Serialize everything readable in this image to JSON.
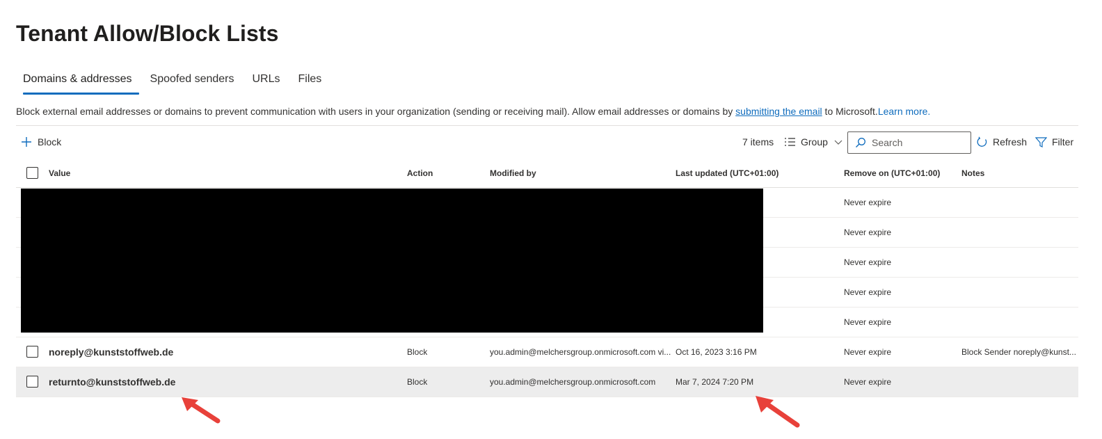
{
  "page": {
    "title": "Tenant Allow/Block Lists"
  },
  "tabs": [
    {
      "label": "Domains & addresses",
      "active": true
    },
    {
      "label": "Spoofed senders",
      "active": false
    },
    {
      "label": "URLs",
      "active": false
    },
    {
      "label": "Files",
      "active": false
    }
  ],
  "description": {
    "text": "Block external email addresses or domains to prevent communication with users in your organization (sending or receiving mail). Allow email addresses or domains by ",
    "link": "submitting the email",
    "after": " to Microsoft.",
    "learn_more": "Learn more."
  },
  "toolbar": {
    "block_label": "Block",
    "items_count": "7 items",
    "group_label": "Group",
    "search_placeholder": "Search",
    "refresh_label": "Refresh",
    "filter_label": "Filter"
  },
  "table": {
    "columns": {
      "value": "Value",
      "action": "Action",
      "modified_by": "Modified by",
      "last_updated": "Last updated (UTC+01:00)",
      "remove_on": "Remove on (UTC+01:00)",
      "notes": "Notes"
    },
    "rows": [
      {
        "value": "",
        "action": "",
        "modified_by": "",
        "last_updated": "",
        "remove_on": "Never expire",
        "notes": "",
        "redacted": true
      },
      {
        "value": "",
        "action": "",
        "modified_by": "",
        "last_updated": "",
        "remove_on": "Never expire",
        "notes": "",
        "redacted": true
      },
      {
        "value": "",
        "action": "",
        "modified_by": "",
        "last_updated": "",
        "remove_on": "Never expire",
        "notes": "",
        "redacted": true
      },
      {
        "value": "",
        "action": "",
        "modified_by": "",
        "last_updated": "",
        "remove_on": "Never expire",
        "notes": "",
        "redacted": true
      },
      {
        "value": "",
        "action": "",
        "modified_by": "",
        "last_updated": "",
        "remove_on": "Never expire",
        "notes": "",
        "redacted": true
      },
      {
        "value": "noreply@kunststoffweb.de",
        "action": "Block",
        "modified_by": "you.admin@melchersgroup.onmicrosoft.com vi...",
        "last_updated": "Oct 16, 2023 3:16 PM",
        "remove_on": "Never expire",
        "notes": "Block Sender noreply@kunst..."
      },
      {
        "value": "returnto@kunststoffweb.de",
        "action": "Block",
        "modified_by": "you.admin@melchersgroup.onmicrosoft.com",
        "last_updated": "Mar 7, 2024 7:20 PM",
        "remove_on": "Never expire",
        "notes": "",
        "selected": true
      }
    ]
  },
  "colors": {
    "accent": "#0f6cbd",
    "annotation_arrow": "#e8413a",
    "selected_row": "#ededed"
  },
  "icons": [
    "plus-icon",
    "group-list-icon",
    "chevron-down-icon",
    "search-icon",
    "refresh-icon",
    "filter-icon"
  ]
}
